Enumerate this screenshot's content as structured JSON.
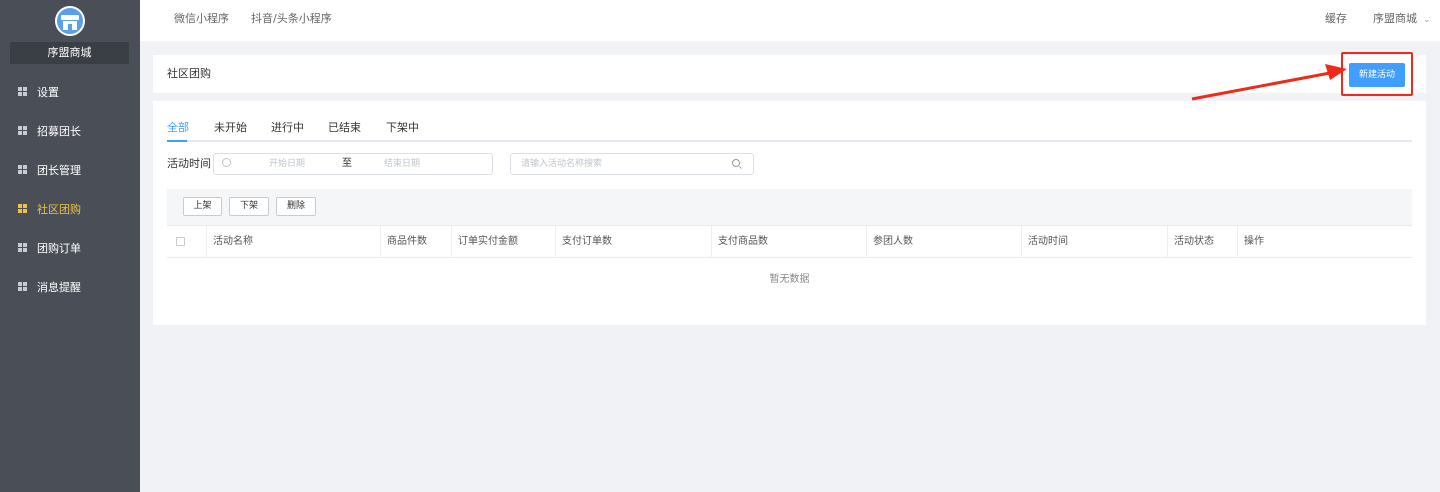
{
  "sidebar": {
    "store_name": "序盟商城",
    "items": [
      {
        "label": "设置"
      },
      {
        "label": "招募团长"
      },
      {
        "label": "团长管理"
      },
      {
        "label": "社区团购"
      },
      {
        "label": "团购订单"
      },
      {
        "label": "消息提醒"
      }
    ],
    "active_index": 3,
    "active_color": "#f0c040"
  },
  "topbar": {
    "tabs": [
      {
        "label": "微信小程序"
      },
      {
        "label": "抖音/头条小程序"
      }
    ],
    "cache_label": "缓存",
    "user_menu": "序盟商城"
  },
  "header": {
    "title": "社区团购",
    "new_button": "新建活动"
  },
  "tabs": [
    {
      "label": "全部"
    },
    {
      "label": "未开始"
    },
    {
      "label": "进行中"
    },
    {
      "label": "已结束"
    },
    {
      "label": "下架中"
    }
  ],
  "filter": {
    "label": "活动时间",
    "start_placeholder": "开始日期",
    "separator": "至",
    "end_placeholder": "结束日期",
    "search_placeholder": "请输入活动名称搜索"
  },
  "toolbar": {
    "buttons": [
      {
        "label": "上架"
      },
      {
        "label": "下架"
      },
      {
        "label": "删除"
      }
    ]
  },
  "table": {
    "columns": [
      "活动名称",
      "商品件数",
      "订单实付金额",
      "支付订单数",
      "支付商品数",
      "参团人数",
      "活动时间",
      "活动状态",
      "操作"
    ],
    "empty_text": "暂无数据"
  },
  "colors": {
    "primary": "#409eff",
    "sidebar_bg": "#4a4f57",
    "highlight": "#ee2a1b"
  }
}
